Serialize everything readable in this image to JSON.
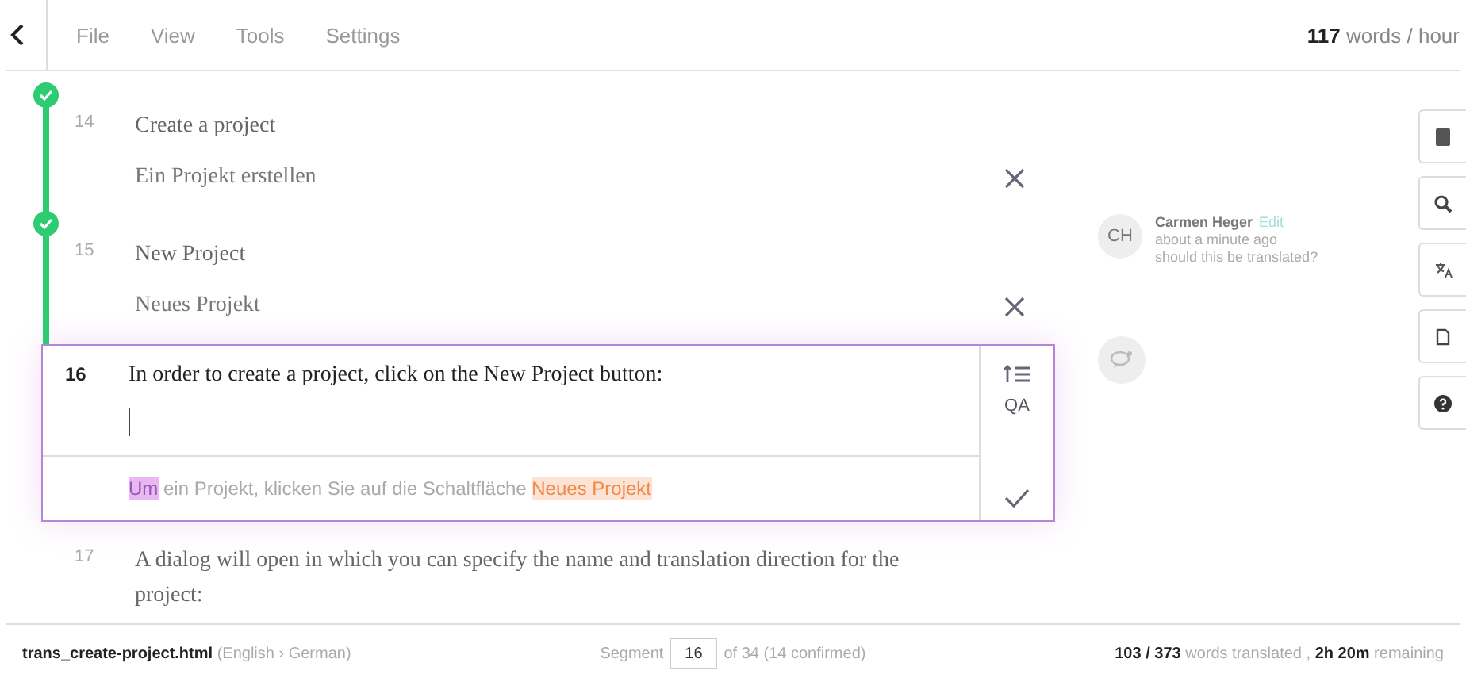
{
  "menu": {
    "items": [
      "File",
      "View",
      "Tools",
      "Settings"
    ],
    "rate": "**117** words / hour"
  },
  "segments": [
    {
      "number": "14",
      "source": "Create a project",
      "target": [
        {
          "text": "Ein Projekt erstellen",
          "kind": "plain"
        }
      ],
      "confirmed": true,
      "active": false
    },
    {
      "number": "15",
      "source": "New Project",
      "target": [
        {
          "text": "Neues Projekt",
          "kind": "plain"
        }
      ],
      "confirmed": true,
      "active": false
    },
    {
      "number": "16",
      "source": "In order to create a project, click on the New Project button:",
      "target": [
        {
          "text": "Um",
          "kind": "term"
        },
        {
          "text": " ein Projekt, klicken Sie auf die Schaltfläche ",
          "kind": "plain"
        },
        {
          "text": "Neues Projekt",
          "kind": "match"
        }
      ],
      "confirmed": false,
      "active": true,
      "actions": [
        "QA"
      ]
    },
    {
      "number": "17",
      "source": "A dialog will open in which you can specify the name and translation direction for the project:",
      "confirmed": false,
      "active": false
    }
  ],
  "comment": {
    "initials": "CH",
    "author": "Carmen Heger",
    "edit": "Edit",
    "time": "about a minute ago",
    "text": "should this be translated?"
  },
  "status_bar": {
    "file": "**trans_create-project.html** (English › German)",
    "segment_label": "Segment",
    "segment_value": "16",
    "segment_total": "of 34 (14 confirmed)",
    "progress": "**103 / 373** words translated , **2h 20m** remaining"
  }
}
